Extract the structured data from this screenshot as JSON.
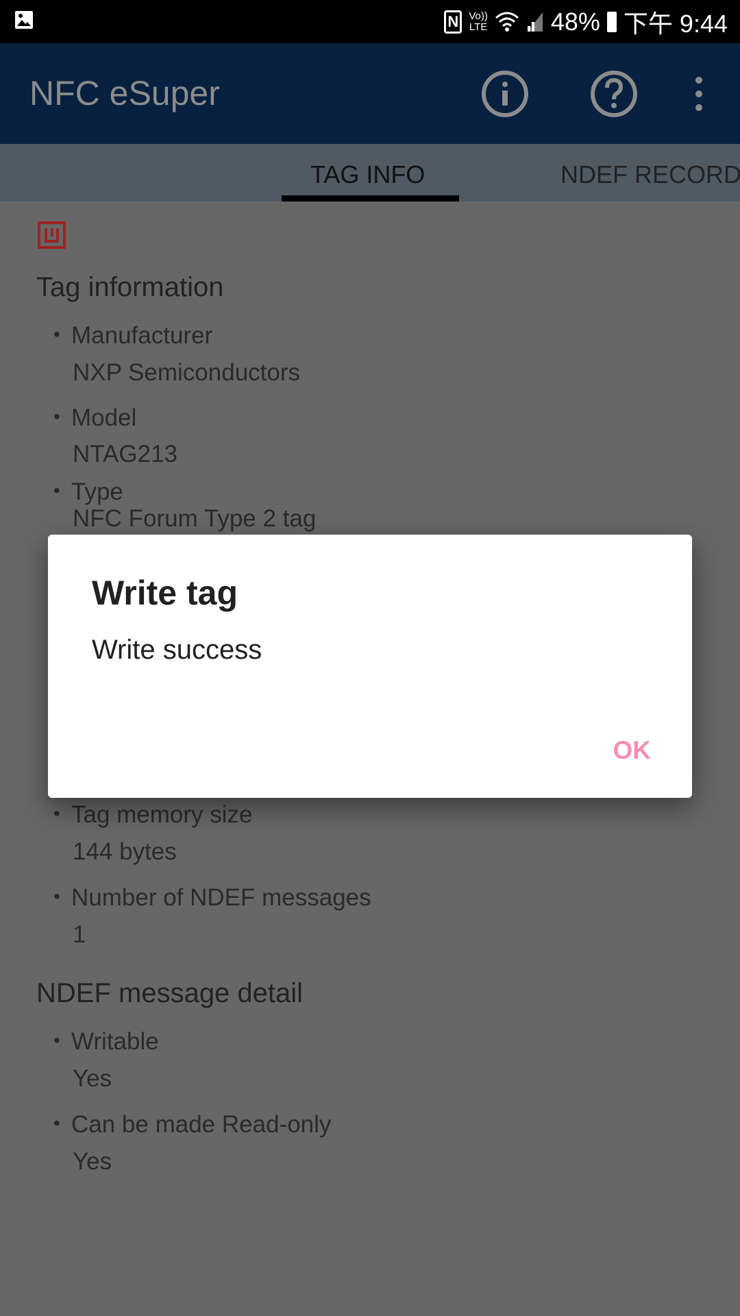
{
  "status_bar": {
    "battery": "48%",
    "time": "下午 9:44",
    "network": "LTE"
  },
  "app_bar": {
    "title": "NFC eSuper",
    "icons": [
      "info-icon",
      "help-icon",
      "more-vert-icon"
    ]
  },
  "tabs": [
    {
      "label": "TAG INFO",
      "selected": true
    },
    {
      "label": "NDEF RECORD",
      "selected": false
    }
  ],
  "tag_information": {
    "heading": "Tag information",
    "items": [
      {
        "label": "Manufacturer",
        "value": "NXP Semiconductors"
      },
      {
        "label": "Model",
        "value": "NTAG213"
      },
      {
        "label": "Type",
        "value": "NFC Forum Type 2 tag"
      },
      {
        "label": "Tag memory size",
        "value": "144 bytes"
      },
      {
        "label": "Number of NDEF messages",
        "value": "1"
      }
    ]
  },
  "ndef_detail": {
    "heading": "NDEF message detail",
    "items": [
      {
        "label": "Writable",
        "value": "Yes"
      },
      {
        "label": "Can be made Read-only",
        "value": "Yes"
      }
    ]
  },
  "dialog": {
    "title": "Write tag",
    "message": "Write success",
    "ok_label": "OK"
  },
  "colors": {
    "app_bar": "#12509d",
    "tab_bar": "#c6e1f7",
    "accent": "#f48fb1",
    "nfc_icon": "#c62828"
  }
}
